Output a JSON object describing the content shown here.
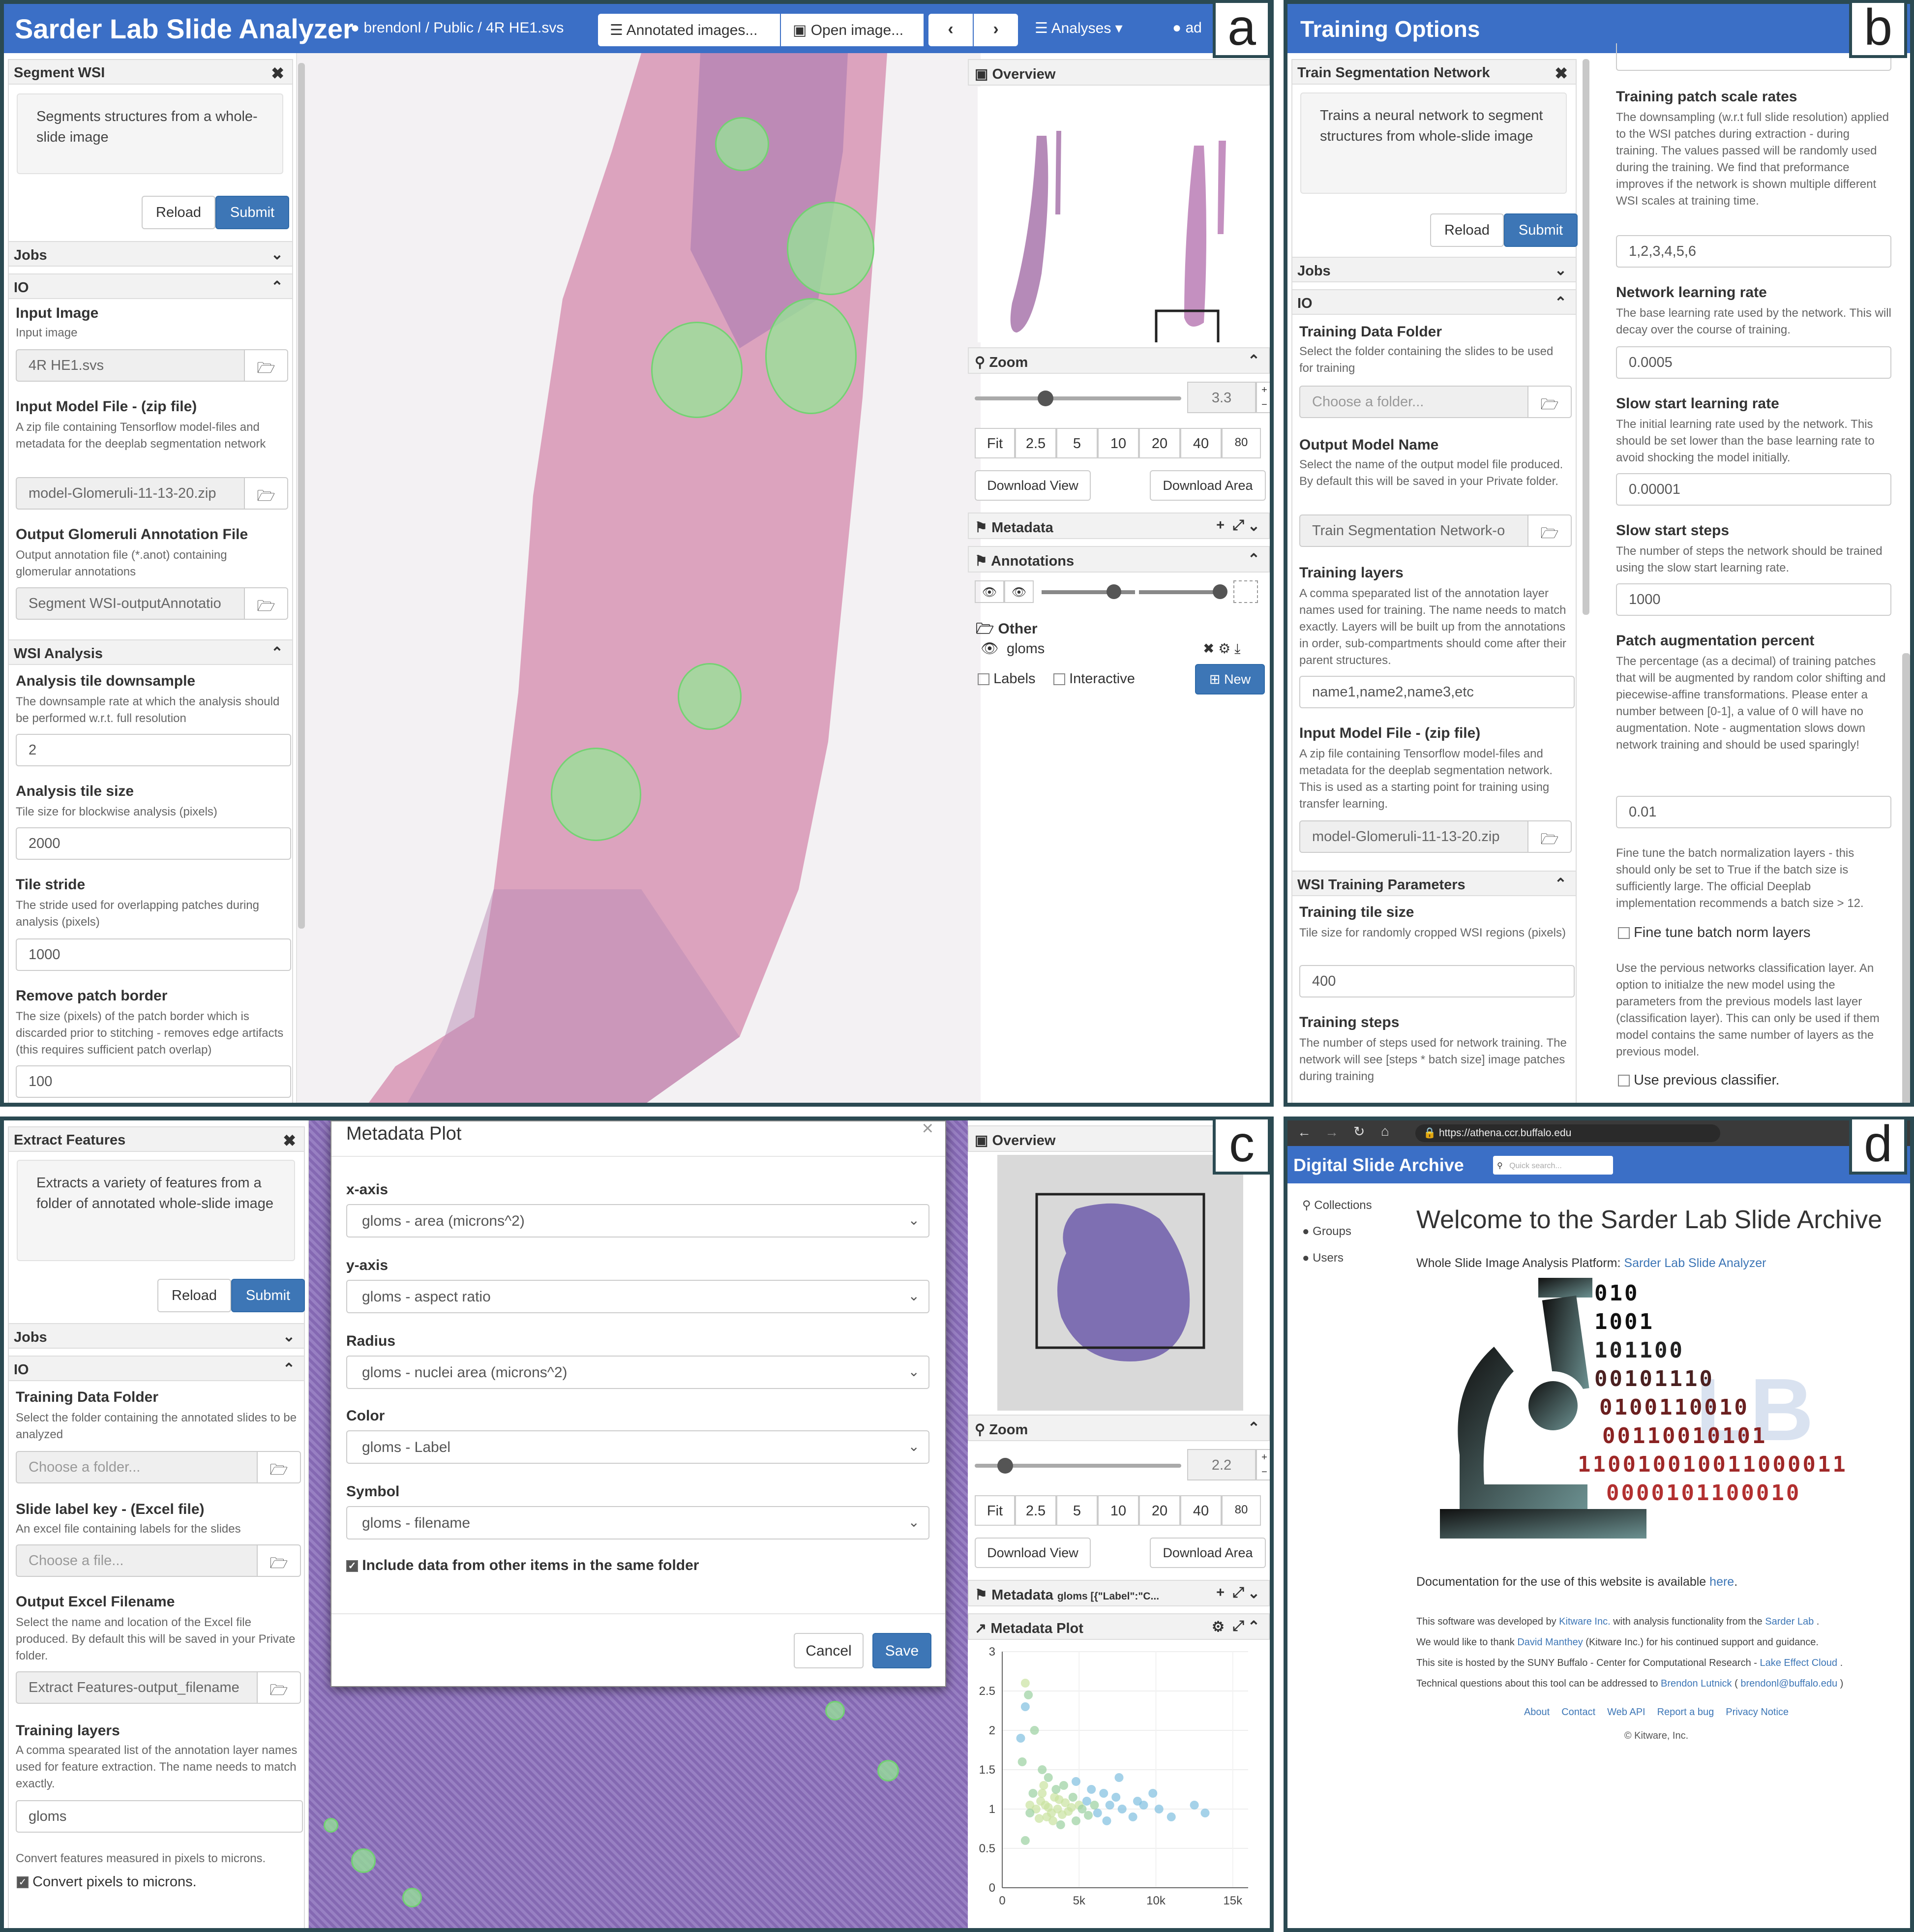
{
  "panel_letters": {
    "a": "a",
    "b": "b",
    "c": "c",
    "d": "d"
  },
  "a": {
    "app_title": "Sarder Lab Slide Analyzer",
    "breadcrumb": {
      "user": "brendonl",
      "sep1": "/",
      "folder": "Public",
      "sep2": "/",
      "file": "4R HE1.svs"
    },
    "toolbar": {
      "annotated": "Annotated images...",
      "open": "Open image...",
      "analyses": "Analyses",
      "admin": "ad"
    },
    "sidebar": {
      "title": "Segment WSI",
      "description": "Segments structures from a whole-slide image",
      "reload": "Reload",
      "submit": "Submit",
      "jobs": "Jobs",
      "io": "IO",
      "input_image": {
        "label": "Input Image",
        "hint": "Input image",
        "value": "4R HE1.svs"
      },
      "input_model": {
        "label": "Input Model File - (zip file)",
        "hint": "A zip file containing Tensorflow model-files and metadata for the deeplab segmentation network",
        "value": "model-Glomeruli-11-13-20.zip"
      },
      "output_annot": {
        "label": "Output Glomeruli Annotation File",
        "hint": "Output annotation file (*.anot) containing glomerular annotations",
        "value": "Segment WSI-outputAnnotatio"
      },
      "wsi_analysis": "WSI Analysis",
      "downsample": {
        "label": "Analysis tile downsample",
        "hint": "The downsample rate at which the analysis should be performed w.r.t. full resolution",
        "value": "2"
      },
      "tile_size": {
        "label": "Analysis tile size",
        "hint": "Tile size for blockwise analysis (pixels)",
        "value": "2000"
      },
      "stride": {
        "label": "Tile stride",
        "hint": "The stride used for overlapping patches during analysis (pixels)",
        "value": "1000"
      },
      "border": {
        "label": "Remove patch border",
        "hint": "The size (pixels) of the patch border which is discarded prior to stitching - removes edge artifacts (this requires sufficient patch overlap)",
        "value": "100"
      }
    },
    "right": {
      "overview": "Overview",
      "zoom": "Zoom",
      "zoom_value": "3.3",
      "zoom_buttons": [
        "Fit",
        "2.5",
        "5",
        "10",
        "20",
        "40",
        "80"
      ],
      "download_view": "Download View",
      "download_area": "Download Area",
      "metadata": "Metadata",
      "annotations": "Annotations",
      "group": "Other",
      "layer": "gloms",
      "labels": "Labels",
      "interactive": "Interactive",
      "new": "New"
    }
  },
  "b": {
    "title": "Training Options",
    "card_title": "Train Segmentation Network",
    "description": "Trains a neural network to segment structures from whole-slide image",
    "reload": "Reload",
    "submit": "Submit",
    "jobs": "Jobs",
    "io": "IO",
    "train_folder": {
      "label": "Training Data Folder",
      "hint": "Select the folder containing the slides to be used for training",
      "placeholder": "Choose a folder..."
    },
    "output_name": {
      "label": "Output Model Name",
      "hint": "Select the name of the output model file produced. By default this will be saved in your Private folder.",
      "value": "Train Segmentation Network-o"
    },
    "layers": {
      "label": "Training layers",
      "hint": "A comma speparated list of the annotation layer names used for training. The name needs to match exactly. Layers will be built up from the annotations in order, sub-compartments should come after their parent structures.",
      "value": "name1,name2,name3,etc"
    },
    "input_model": {
      "label": "Input Model File - (zip file)",
      "hint": "A zip file containing Tensorflow model-files and metadata for the deeplab segmentation network. This is used as a starting point for training using transfer learning.",
      "value": "model-Glomeruli-11-13-20.zip"
    },
    "wsi_params": "WSI Training Parameters",
    "tile_size": {
      "label": "Training tile size",
      "hint": "Tile size for randomly cropped WSI regions (pixels)",
      "value": "400"
    },
    "steps": {
      "label": "Training steps",
      "hint": "The number of steps used for network training. The network will see [steps * batch size] image patches during training"
    },
    "scale_rates": {
      "label": "Training patch scale rates",
      "hint": "The downsampling (w.r.t full slide resolution) applied to the WSI patches during extraction - during training. The values passed will be randomly used during the training. We find that preformance improves if the network is shown multiple different WSI scales at training time.",
      "value": "1,2,3,4,5,6"
    },
    "lr": {
      "label": "Network learning rate",
      "hint": "The base learning rate used by the network. This will decay over the course of training.",
      "value": "0.0005"
    },
    "slow_lr": {
      "label": "Slow start learning rate",
      "hint": "The initial learning rate used by the network. This should be set lower than the base learning rate to avoid shocking the model initially.",
      "value": "0.00001"
    },
    "slow_steps": {
      "label": "Slow start steps",
      "hint": "The number of steps the network should be trained using the slow start learning rate.",
      "value": "1000"
    },
    "augment": {
      "label": "Patch augmentation percent",
      "hint": "The percentage (as a decimal) of training patches that will be augmented by random color shifting and piecewise-affine transformations. Please enter a number between [0-1], a value of 0 will have no augmentation. Note - augmentation slows down network training and should be used sparingly!",
      "value": "0.01"
    },
    "finetune_hint": "Fine tune the batch normalization layers - this should only be set to True if the batch size is sufficiently large. The official Deeplab implementation recommends a batch size > 12.",
    "finetune": "Fine tune batch norm layers",
    "prev_hint": "Use the pervious networks classification layer. An option to initialze the new model using the parameters from the previous models last layer (classification layer). This can only be used if them model contains the same number of layers as the previous model.",
    "prev": "Use previous classifier."
  },
  "c": {
    "card_title": "Extract Features",
    "description": "Extracts a variety of features from a folder of annotated whole-slide image",
    "reload": "Reload",
    "submit": "Submit",
    "jobs": "Jobs",
    "io": "IO",
    "folder": {
      "label": "Training Data Folder",
      "hint": "Select the folder containing the annotated slides to be analyzed",
      "placeholder": "Choose a folder..."
    },
    "label_key": {
      "label": "Slide label key - (Excel file)",
      "hint": "An excel file containing labels for the slides",
      "placeholder": "Choose a file..."
    },
    "excel": {
      "label": "Output Excel Filename",
      "hint": "Select the name and location of the Excel file produced. By default this will be saved in your Private folder.",
      "value": "Extract Features-output_filename"
    },
    "layers": {
      "label": "Training layers",
      "hint": "A comma spearated list of the annotation layer names used for feature extraction. The name needs to match exactly.",
      "value": "gloms"
    },
    "convert_hint": "Convert features measured in pixels to microns.",
    "convert": "Convert pixels to microns.",
    "modal": {
      "title": "Metadata Plot",
      "close": "×",
      "xaxis": {
        "label": "x-axis",
        "value": "gloms - area (microns^2)"
      },
      "yaxis": {
        "label": "y-axis",
        "value": "gloms - aspect ratio"
      },
      "radius": {
        "label": "Radius",
        "value": "gloms - nuclei area (microns^2)"
      },
      "color": {
        "label": "Color",
        "value": "gloms - Label"
      },
      "symbol": {
        "label": "Symbol",
        "value": "gloms - filename"
      },
      "include": "Include data from other items in the same folder",
      "cancel": "Cancel",
      "save": "Save"
    },
    "right": {
      "overview": "Overview",
      "zoom": "Zoom",
      "zoom_value": "2.2",
      "zoom_buttons": [
        "Fit",
        "2.5",
        "5",
        "10",
        "20",
        "40",
        "80"
      ],
      "download_view": "Download View",
      "download_area": "Download Area",
      "metadata": "Metadata",
      "metadata_extra": "gloms [{\"Label\":\"C...",
      "plot_title": "Metadata Plot"
    }
  },
  "chart_data": {
    "type": "scatter",
    "title": "",
    "xlabel": "",
    "ylabel": "",
    "x_ticks": [
      "0",
      "5k",
      "10k",
      "15k"
    ],
    "y_ticks": [
      "0",
      "0.5",
      "1",
      "1.5",
      "2",
      "2.5",
      "3"
    ],
    "xlim": [
      0,
      16000
    ],
    "ylim": [
      0,
      3
    ],
    "series": [
      {
        "color": "#c9e3a0",
        "points": [
          [
            2800,
            1.05
          ],
          [
            3200,
            0.95
          ],
          [
            2500,
            1.1
          ],
          [
            3600,
            1.0
          ],
          [
            4100,
            1.08
          ],
          [
            2900,
            0.9
          ],
          [
            3400,
            1.15
          ],
          [
            2200,
            1.0
          ],
          [
            3900,
            0.93
          ],
          [
            4500,
            1.02
          ],
          [
            2600,
            1.2
          ],
          [
            3000,
            1.02
          ],
          [
            3700,
            1.12
          ],
          [
            2400,
            0.88
          ],
          [
            4300,
            0.97
          ],
          [
            1800,
            1.05
          ],
          [
            3300,
            0.85
          ],
          [
            2700,
            1.3
          ],
          [
            5000,
            1.05
          ],
          [
            1500,
            2.6
          ]
        ]
      },
      {
        "color": "#7fbfe0",
        "points": [
          [
            5500,
            1.1
          ],
          [
            6200,
            0.95
          ],
          [
            7000,
            1.05
          ],
          [
            6600,
            1.2
          ],
          [
            7800,
            1.0
          ],
          [
            8500,
            0.9
          ],
          [
            9200,
            1.05
          ],
          [
            5800,
            1.25
          ],
          [
            7400,
            1.15
          ],
          [
            8800,
            1.1
          ],
          [
            10200,
            1.0
          ],
          [
            11000,
            0.9
          ],
          [
            9800,
            1.2
          ],
          [
            6800,
            0.85
          ],
          [
            12500,
            1.05
          ],
          [
            4800,
            1.35
          ],
          [
            13200,
            0.95
          ],
          [
            7600,
            1.4
          ],
          [
            1200,
            1.9
          ],
          [
            1500,
            2.3
          ]
        ]
      },
      {
        "color": "#9ad0a0",
        "points": [
          [
            4000,
            1.3
          ],
          [
            4800,
            0.85
          ],
          [
            5200,
            1.0
          ],
          [
            6000,
            1.05
          ],
          [
            3500,
            1.25
          ],
          [
            4600,
            1.15
          ],
          [
            5600,
            0.92
          ],
          [
            2000,
            1.2
          ],
          [
            1800,
            0.95
          ],
          [
            3800,
            0.8
          ],
          [
            2600,
            1.5
          ],
          [
            3000,
            1.4
          ],
          [
            1300,
            1.6
          ],
          [
            2100,
            2.0
          ],
          [
            1700,
            2.45
          ],
          [
            1500,
            0.6
          ]
        ]
      }
    ]
  },
  "d": {
    "url": "https://athena.ccr.buffalo.edu",
    "site_title": "Digital Slide Archive",
    "search_placeholder": "Quick search...",
    "nav": {
      "collections": "Collections",
      "groups": "Groups",
      "users": "Users"
    },
    "welcome": "Welcome to the Sarder Lab Slide Archive",
    "platform_label": "Whole Slide Image Analysis Platform:",
    "platform_link": "Sarder Lab Slide Analyzer",
    "binary": [
      "010",
      "1001",
      "101100",
      "00101110",
      "0100110010",
      "00110010101",
      "110010010011000011",
      "0000101100010"
    ],
    "doc_text": "Documentation for the use of this website is available",
    "doc_link": "here",
    "credits": [
      {
        "pre": "This software was developed by",
        "l1": "Kitware Inc.",
        "mid": "with analysis functionality from the",
        "l2": "Sarder Lab",
        "post": "."
      },
      {
        "pre": "We would like to thank",
        "l1": "David Manthey",
        "mid": "(Kitware Inc.) for his continued support and guidance.",
        "l2": "",
        "post": ""
      },
      {
        "pre": "This site is hosted by the SUNY Buffalo - Center for Computational Research -",
        "l1": "Lake Effect Cloud",
        "mid": ".",
        "l2": "",
        "post": ""
      },
      {
        "pre": "Technical questions about this tool can be addressed to",
        "l1": "Brendon Lutnick",
        "mid": "(",
        "l2": "brendonl@buffalo.edu",
        "post": ")"
      }
    ],
    "footer_links": [
      "About",
      "Contact",
      "Web API",
      "Report a bug",
      "Privacy Notice"
    ],
    "copyright": "© Kitware, Inc."
  }
}
